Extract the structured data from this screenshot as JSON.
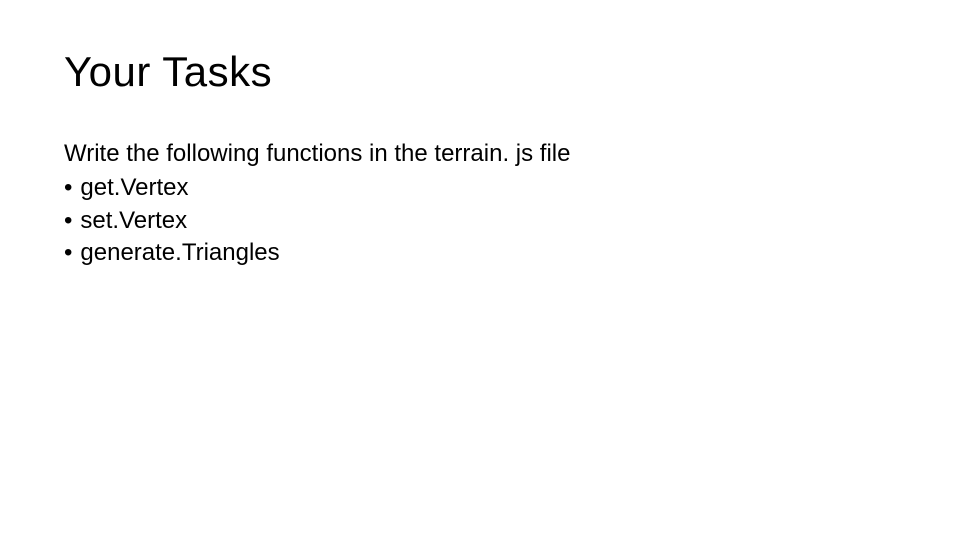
{
  "title": "Your Tasks",
  "intro": "Write the following functions in the terrain. js file",
  "bullets": [
    "get.Vertex",
    "set.Vertex",
    "generate.Triangles"
  ]
}
